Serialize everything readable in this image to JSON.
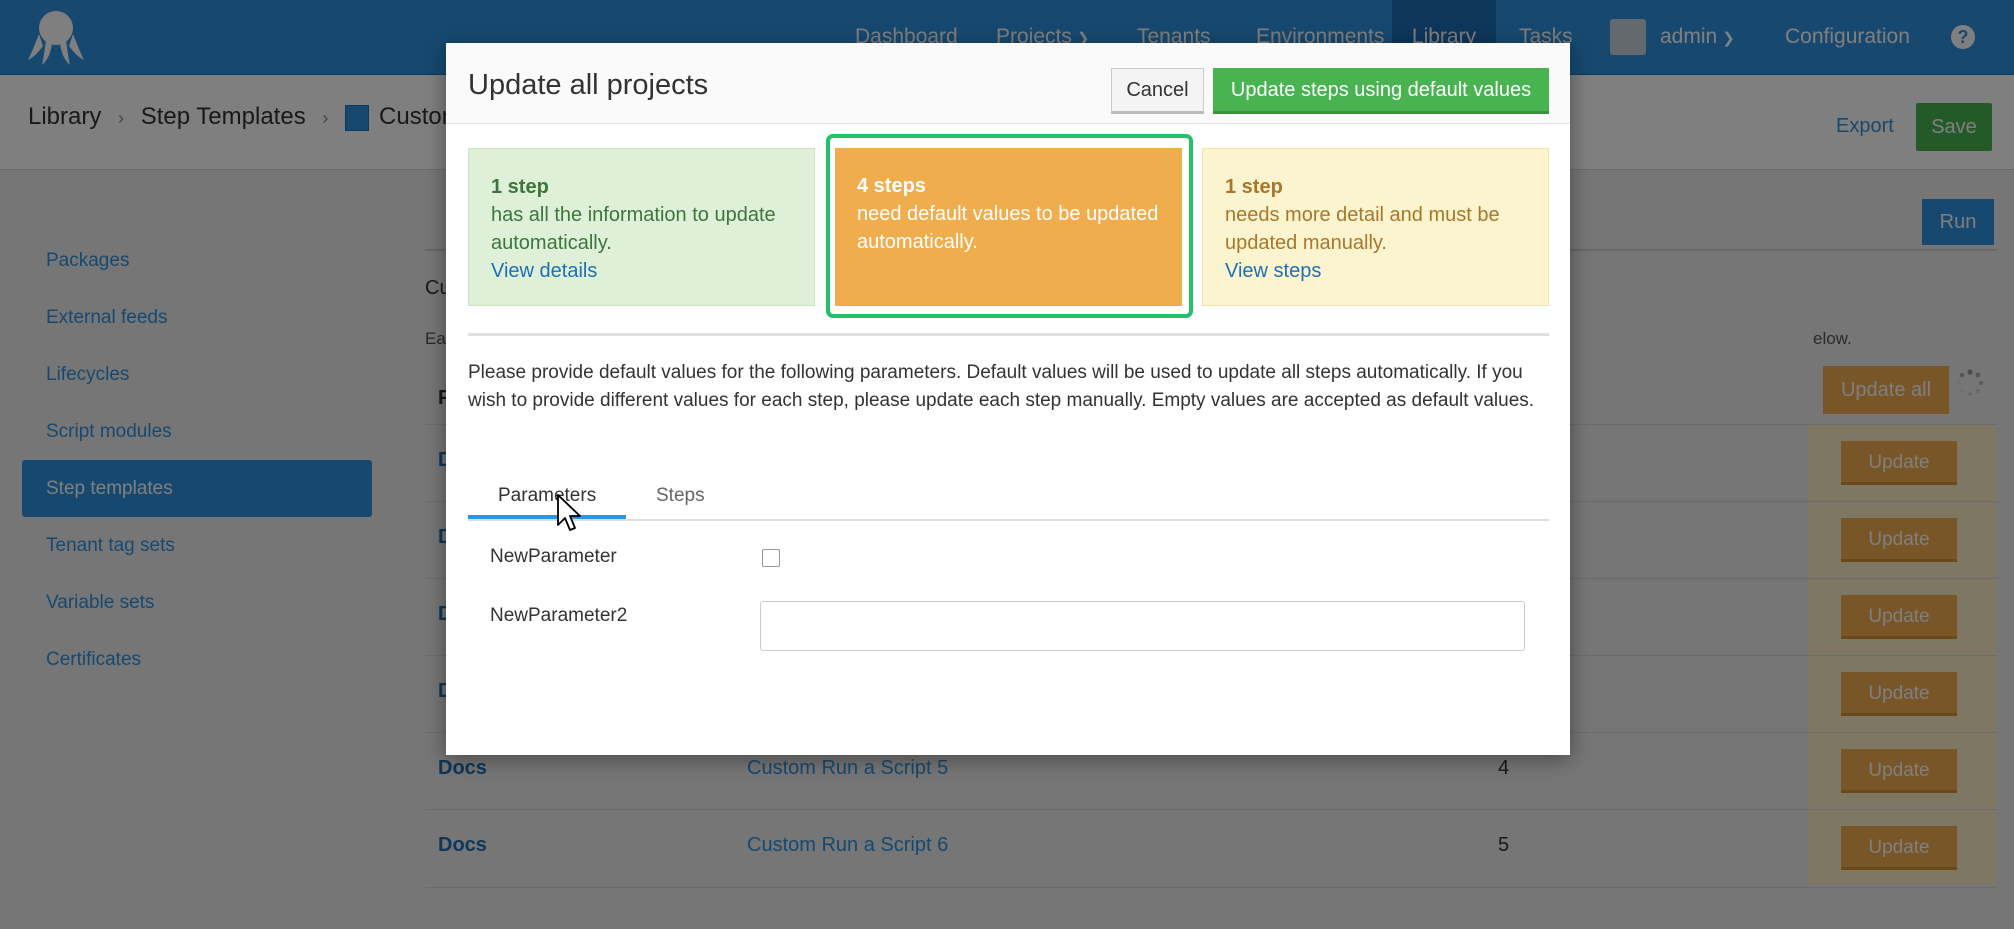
{
  "topnav": {
    "items": [
      "Dashboard",
      "Projects",
      "Tenants",
      "Environments",
      "Library",
      "Tasks"
    ],
    "user": "admin",
    "configuration": "Configuration",
    "help": "?"
  },
  "header": {
    "breadcrumbs": [
      "Library",
      "Step Templates",
      "Custom"
    ],
    "export": "Export",
    "save": "Save"
  },
  "sidebar": {
    "items": [
      {
        "label": "Packages"
      },
      {
        "label": "External feeds"
      },
      {
        "label": "Lifecycles"
      },
      {
        "label": "Script modules"
      },
      {
        "label": "Step templates"
      },
      {
        "label": "Tenant tag sets"
      },
      {
        "label": "Variable sets"
      },
      {
        "label": "Certificates"
      }
    ],
    "active_index": 4
  },
  "main": {
    "run": "Run",
    "cu_text": "Cu",
    "ea_text": "Ea",
    "below_text": "elow.",
    "first_col_header": "P",
    "update_all": "Update all",
    "rows": [
      {
        "project": "D",
        "step": "",
        "version": ""
      },
      {
        "project": "D",
        "step": "",
        "version": ""
      },
      {
        "project": "D",
        "step": "",
        "version": ""
      },
      {
        "project": "D",
        "step": "",
        "version": ""
      },
      {
        "project": "Docs",
        "step": "Custom Run a Script 5",
        "version": "4"
      },
      {
        "project": "Docs",
        "step": "Custom Run a Script 6",
        "version": "5"
      }
    ],
    "update_label": "Update"
  },
  "modal": {
    "title": "Update all projects",
    "cancel": "Cancel",
    "update_steps": "Update steps using default values",
    "cards": [
      {
        "count": "1 step",
        "text": "has all the information to update automatically.",
        "link": "View details"
      },
      {
        "count": "4 steps",
        "text": "need default values to be updated automatically.",
        "link": ""
      },
      {
        "count": "1 step",
        "text": "needs more detail and must be updated manually.",
        "link": "View steps"
      }
    ],
    "instructions": "Please provide default values for the following parameters. Default values will be used to update all steps automatically. If you wish to provide different values for each step, please update each step manually. Empty values are accepted as default values.",
    "tabs": [
      "Parameters",
      "Steps"
    ],
    "active_tab": 0,
    "params": [
      {
        "name": "NewParameter",
        "type": "checkbox",
        "checked": false
      },
      {
        "name": "NewParameter2",
        "type": "text",
        "value": ""
      }
    ]
  },
  "colors": {
    "primary": "#2f93e0",
    "success": "#48b350",
    "warning": "#f0ad4e",
    "highlight": "#22c16a"
  }
}
